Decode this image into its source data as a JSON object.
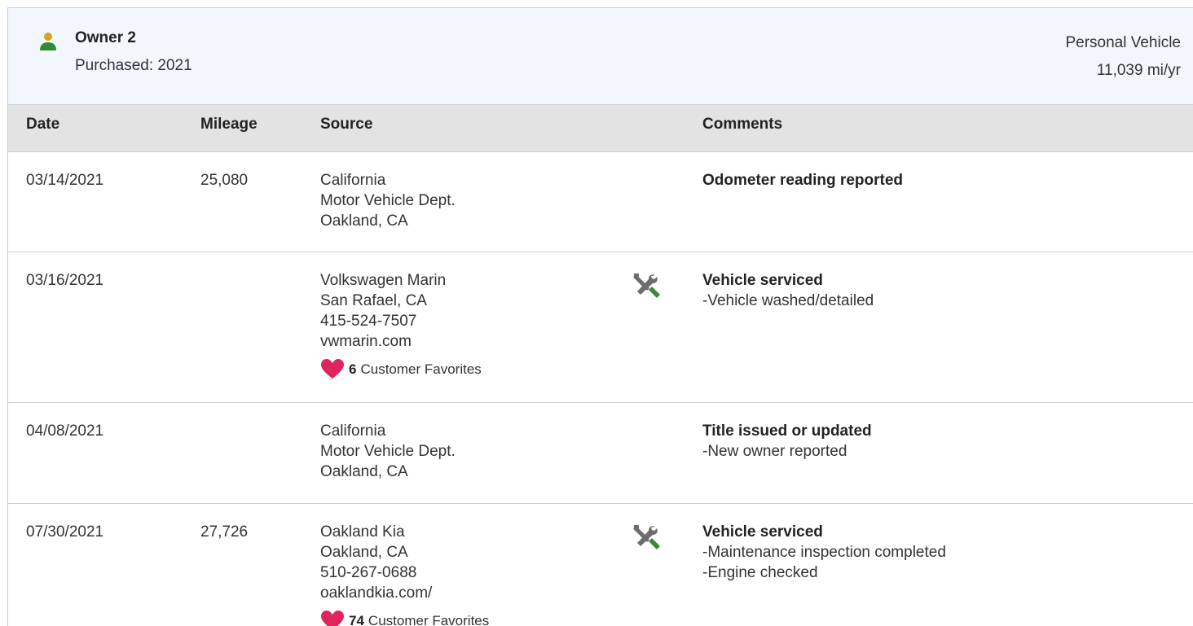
{
  "owner": {
    "name": "Owner 2",
    "purchased": "Purchased: 2021",
    "vehicle_type": "Personal Vehicle",
    "usage": "11,039 mi/yr",
    "icon": "person-icon"
  },
  "table": {
    "headers": {
      "date": "Date",
      "mileage": "Mileage",
      "source": "Source",
      "comments": "Comments"
    },
    "rows": [
      {
        "date": "03/14/2021",
        "mileage": "25,080",
        "source": [
          "California",
          "Motor Vehicle Dept.",
          "Oakland, CA"
        ],
        "icon": "",
        "comment_title": "Odometer reading reported",
        "comment_details": []
      },
      {
        "date": "03/16/2021",
        "mileage": "",
        "source": [
          "Volkswagen Marin",
          "San Rafael, CA",
          "415-524-7507",
          "vwmarin.com"
        ],
        "favorites_count": "6",
        "favorites_label": "Customer Favorites",
        "icon": "service-tools-icon",
        "comment_title": "Vehicle serviced",
        "comment_details": [
          "-Vehicle washed/detailed"
        ]
      },
      {
        "date": "04/08/2021",
        "mileage": "",
        "source": [
          "California",
          "Motor Vehicle Dept.",
          "Oakland, CA"
        ],
        "icon": "",
        "comment_title": "Title issued or updated",
        "comment_details": [
          "-New owner reported"
        ]
      },
      {
        "date": "07/30/2021",
        "mileage": "27,726",
        "source": [
          "Oakland Kia",
          "Oakland, CA",
          "510-267-0688",
          "oaklandkia.com/"
        ],
        "favorites_count": "74",
        "favorites_label": "Customer Favorites",
        "icon": "service-tools-icon",
        "comment_title": "Vehicle serviced",
        "comment_details": [
          "-Maintenance inspection completed",
          "-Engine checked"
        ]
      }
    ]
  },
  "colors": {
    "header_bg": "#f1f7fc",
    "column_header_bg": "#e3e3e3",
    "heart": "#e0245e",
    "service_green": "#3a8a3a",
    "service_grey": "#6d6d6d",
    "owner_icon_head": "#d8a21a",
    "owner_icon_body": "#2e8b3a"
  }
}
